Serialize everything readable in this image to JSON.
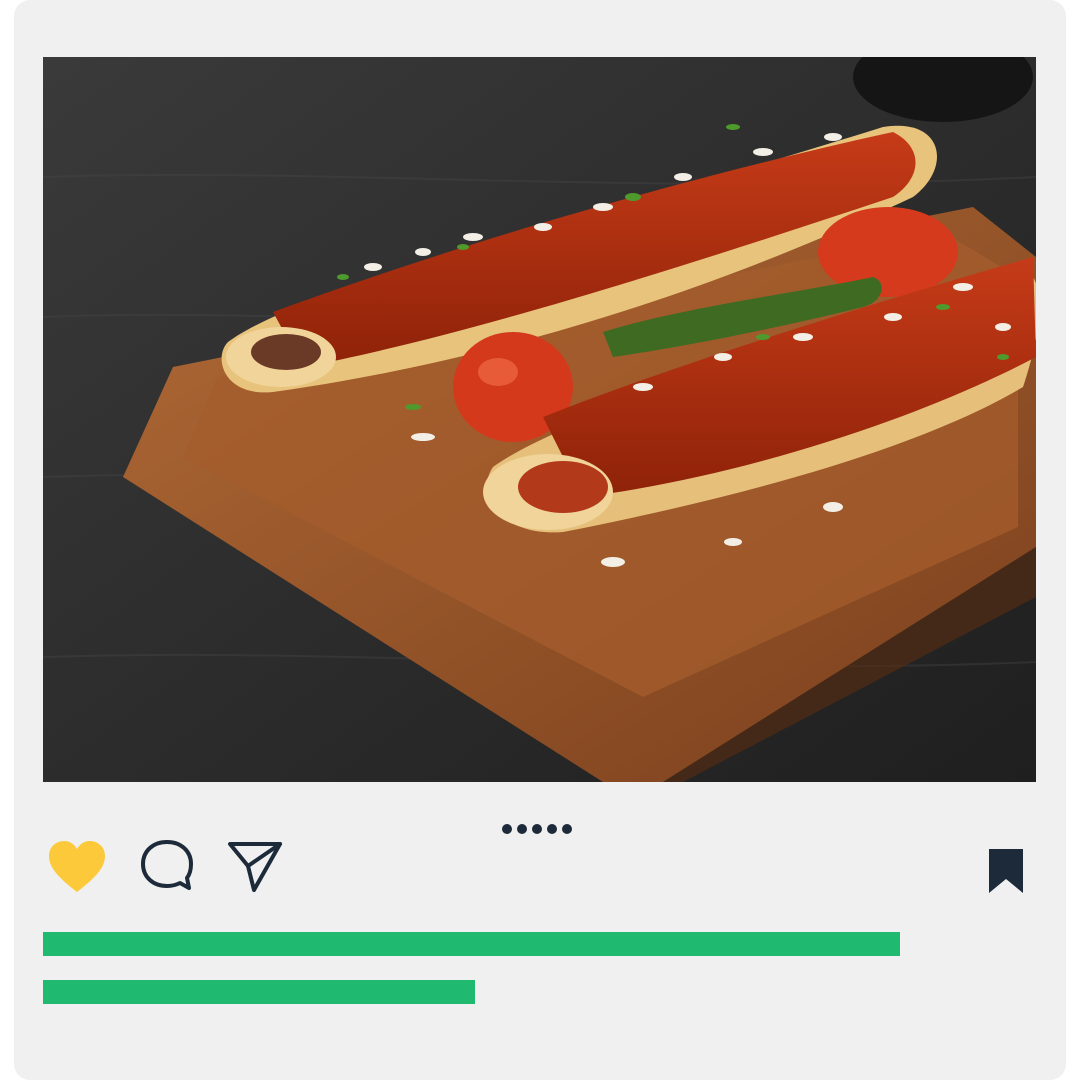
{
  "post": {
    "image_alt": "",
    "carousel": {
      "count": 5,
      "active_index": 0
    },
    "actions": {
      "like_icon": "heart-filled-icon",
      "comment_icon": "speech-bubble-icon",
      "share_icon": "paper-plane-icon",
      "save_icon": "bookmark-filled-icon"
    },
    "caption_placeholder": {
      "line1_fraction": 0.863,
      "line2_fraction": 0.435
    }
  },
  "colors": {
    "card_bg": "#f0f0f0",
    "like": "#fcc93a",
    "icon_dark": "#1d2a3a",
    "placeholder_bar": "#1fba6f"
  }
}
